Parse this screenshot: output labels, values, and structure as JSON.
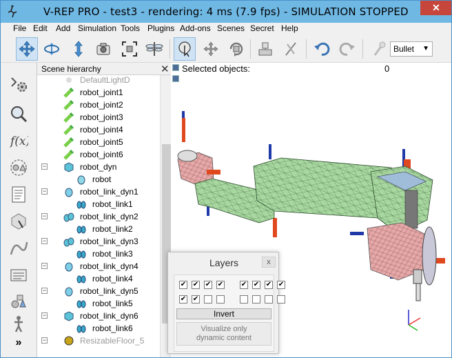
{
  "window": {
    "title": "V-REP PRO - test3 - rendering: 4 ms (7.9 fps) - SIMULATION STOPPED",
    "close_glyph": "✕"
  },
  "menu": [
    "File",
    "Edit",
    "Add",
    "Simulation",
    "Tools",
    "Plugins",
    "Add-ons",
    "Scenes",
    "Secret",
    "Help"
  ],
  "toolbar": {
    "icons": [
      "move-camera-icon",
      "rotate-camera-icon",
      "shift-camera-icon",
      "camera-icon",
      "fit-view-icon",
      "dragonfly-icon",
      "object-select-icon",
      "object-shift-icon",
      "object-rotate-icon",
      "assemble-icon",
      "transfer-dna-icon",
      "undo-icon",
      "redo-icon",
      "simulation-settings-icon"
    ],
    "physics_engine": "Bullet",
    "dropdown_arrow": "▼"
  },
  "left_toolbar": {
    "icons": [
      "simulation-settings-icon",
      "selection-icon",
      "calculation-modules-icon",
      "collections-icon",
      "scripts-icon",
      "shapes-edit-icon",
      "path-edit-icon",
      "user-settings-icon",
      "model-browser-icon",
      "scene-hierarchy-icon"
    ],
    "more_glyph": "»"
  },
  "hierarchy": {
    "title": "Scene hierarchy",
    "close_glyph": "✕",
    "items": [
      {
        "label": "DefaultLightD",
        "icon": "light-icon"
      },
      {
        "label": "robot_joint1",
        "icon": "joint-icon"
      },
      {
        "label": "robot_joint2",
        "icon": "joint-icon"
      },
      {
        "label": "robot_joint3",
        "icon": "joint-icon"
      },
      {
        "label": "robot_joint4",
        "icon": "joint-icon"
      },
      {
        "label": "robot_joint5",
        "icon": "joint-icon"
      },
      {
        "label": "robot_joint6",
        "icon": "joint-icon"
      },
      {
        "label": "robot_dyn",
        "icon": "shape-cube-icon"
      },
      {
        "label": "robot",
        "icon": "shape-icon"
      },
      {
        "label": "robot_link_dyn1",
        "icon": "shape-sphere-icon"
      },
      {
        "label": "robot_link1",
        "icon": "shape-multi-icon"
      },
      {
        "label": "robot_link_dyn2",
        "icon": "shape-multi-sphere-icon"
      },
      {
        "label": "robot_link2",
        "icon": "shape-multi-icon"
      },
      {
        "label": "robot_link_dyn3",
        "icon": "shape-multi-sphere-icon"
      },
      {
        "label": "robot_link3",
        "icon": "shape-multi-icon"
      },
      {
        "label": "robot_link_dyn4",
        "icon": "shape-sphere-icon"
      },
      {
        "label": "robot_link4",
        "icon": "shape-multi-icon"
      },
      {
        "label": "robot_link_dyn5",
        "icon": "shape-sphere-icon"
      },
      {
        "label": "robot_link5",
        "icon": "shape-multi-icon"
      },
      {
        "label": "robot_link_dyn6",
        "icon": "shape-cube-icon"
      },
      {
        "label": "robot_link6",
        "icon": "shape-multi-icon"
      },
      {
        "label": "ResizableFloor_5",
        "icon": "model-icon"
      }
    ]
  },
  "viewport": {
    "selected_label": "Selected objects:",
    "selected_count": "0"
  },
  "layers": {
    "title": "Layers",
    "close_glyph": "x",
    "row1": [
      true,
      true,
      true,
      true,
      true,
      true,
      true,
      true
    ],
    "row2": [
      true,
      true,
      false,
      false,
      false,
      false,
      false,
      false
    ],
    "invert_label": "Invert",
    "visualize_label_line1": "Visualize only",
    "visualize_label_line2": "dynamic content"
  },
  "colors": {
    "titlebar": "#6fb8e4",
    "close": "#c7463b",
    "link_green": "#a8d8a0",
    "link_pink": "#e6a8a8",
    "axis_red": "#e0481e",
    "axis_blue": "#1f3aa8"
  }
}
